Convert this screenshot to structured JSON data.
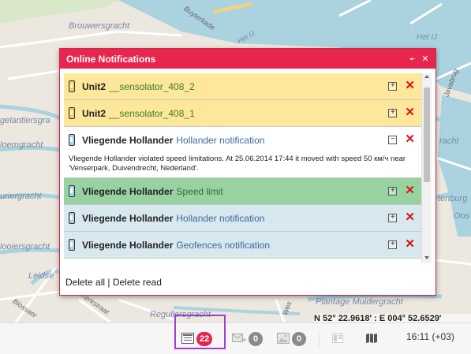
{
  "map": {
    "labels": {
      "brouwersgracht": "Brouwersgracht",
      "buyterkade": "Buyterkade",
      "het_ij_1": "Het IJ",
      "het_ij_2": "Het IJ",
      "javabrug": "Javabrug",
      "elantiersgracht": "gelantiersgra",
      "loemgracht": "loemgracht",
      "riergracht": "uriergracht",
      "lijnbaansgracht": "Leidse",
      "ooiersgracht": "looiersgracht",
      "racht_right": "racht",
      "tenburg": "tenburg",
      "oos": "Oos",
      "plantage": "Plantage Muidergracht",
      "regulier": "Reguliersgracht",
      "karkstraat": "Kerkstraat",
      "weesperstraat": "Wes",
      "bottom_left": "Blossaer"
    },
    "coordinates": "N 52° 22.9618' : E 004° 52.6529'"
  },
  "notifications_window": {
    "title": "Online Notifications",
    "controls": {
      "collapse": "≈",
      "close": "✕"
    },
    "items": [
      {
        "unit": "Unit2",
        "name": "__sensolator_408_2",
        "color": "yellow",
        "expand": "⊞",
        "delete": "✕"
      },
      {
        "unit": "Unit2",
        "name": "__sensolator_408_1",
        "color": "yellow",
        "expand": "⊞",
        "delete": "✕"
      },
      {
        "unit": "Vliegende Hollander",
        "name": "Hollander notification",
        "color": "white",
        "expand": "⊟",
        "delete": "✕",
        "text": "Vliegende Hollander violated speed limitations. At 25.06.2014 17:44 it moved with speed 50 км/ч near 'Venserpark, Duivendrecht, Nederland'."
      },
      {
        "unit": "Vliegende Hollander",
        "name": "Speed limit",
        "color": "green",
        "expand": "⊞",
        "delete": "✕"
      },
      {
        "unit": "Vliegende Hollander",
        "name": "Hollander notification",
        "color": "blue",
        "expand": "⊞",
        "delete": "✕"
      },
      {
        "unit": "Vliegende Hollander",
        "name": "Geofences notification",
        "color": "blue",
        "expand": "⊞",
        "delete": "✕"
      }
    ],
    "footer": {
      "delete_all": "Delete all",
      "separator": " | ",
      "delete_read": "Delete read"
    }
  },
  "statusbar": {
    "notifications_icon": "notifications-list-icon",
    "notifications_count": "22",
    "messages_icon": "messages-icon",
    "messages_count": "0",
    "images_icon": "images-icon",
    "images_count": "0",
    "panel_icon": "panel-icon",
    "map_icon": "map-icon",
    "clock": "16:11 (+03)",
    "colors": {
      "notif_badge": "#e8254d",
      "gray_badge": "#8a8a8a",
      "highlight": "#a23ad6"
    }
  }
}
